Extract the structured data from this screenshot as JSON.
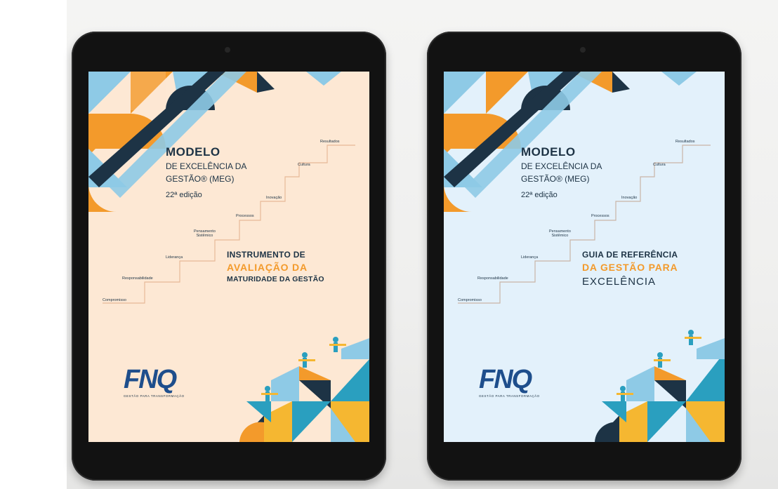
{
  "tablets": [
    {
      "title": "MODELO",
      "line1": "DE EXCELÊNCIA DA",
      "line2": "GESTÃO® (MEG)",
      "edition": "22ª edição",
      "subtitle1": "INSTRUMENTO DE",
      "subtitle2": "AVALIAÇÃO DA",
      "subtitle3": "MATURIDADE DA GESTÃO",
      "background": "#fde8d4"
    },
    {
      "title": "MODELO",
      "line1": "DE EXCELÊNCIA DA",
      "line2": "GESTÃO® (MEG)",
      "edition": "22ª edição",
      "subtitle1": "GUIA DE REFERÊNCIA",
      "subtitle2": "DA GESTÃO PARA",
      "subtitle3": "EXCELÊNCIA",
      "background": "#e3f1fb"
    }
  ],
  "stairs": {
    "compromisso": "Compromisso",
    "responsabilidade": "Responsabilidade",
    "lideranca": "Liderança",
    "pensamento": "Pensamento",
    "sistemico": "Sistêmico",
    "processos": "Processos",
    "inovacao": "Inovação",
    "cultura": "Cultura",
    "resultados": "Resultados"
  },
  "logo": {
    "text": "FNQ",
    "tagline": "GESTÃO PARA TRANSFORMAÇÃO"
  },
  "colors": {
    "navy": "#1d3345",
    "orange": "#f39a2b",
    "light_blue": "#8ecae6",
    "teal": "#2a9fbf",
    "yellow": "#f5b731",
    "logo_blue": "#1e4e8c"
  }
}
